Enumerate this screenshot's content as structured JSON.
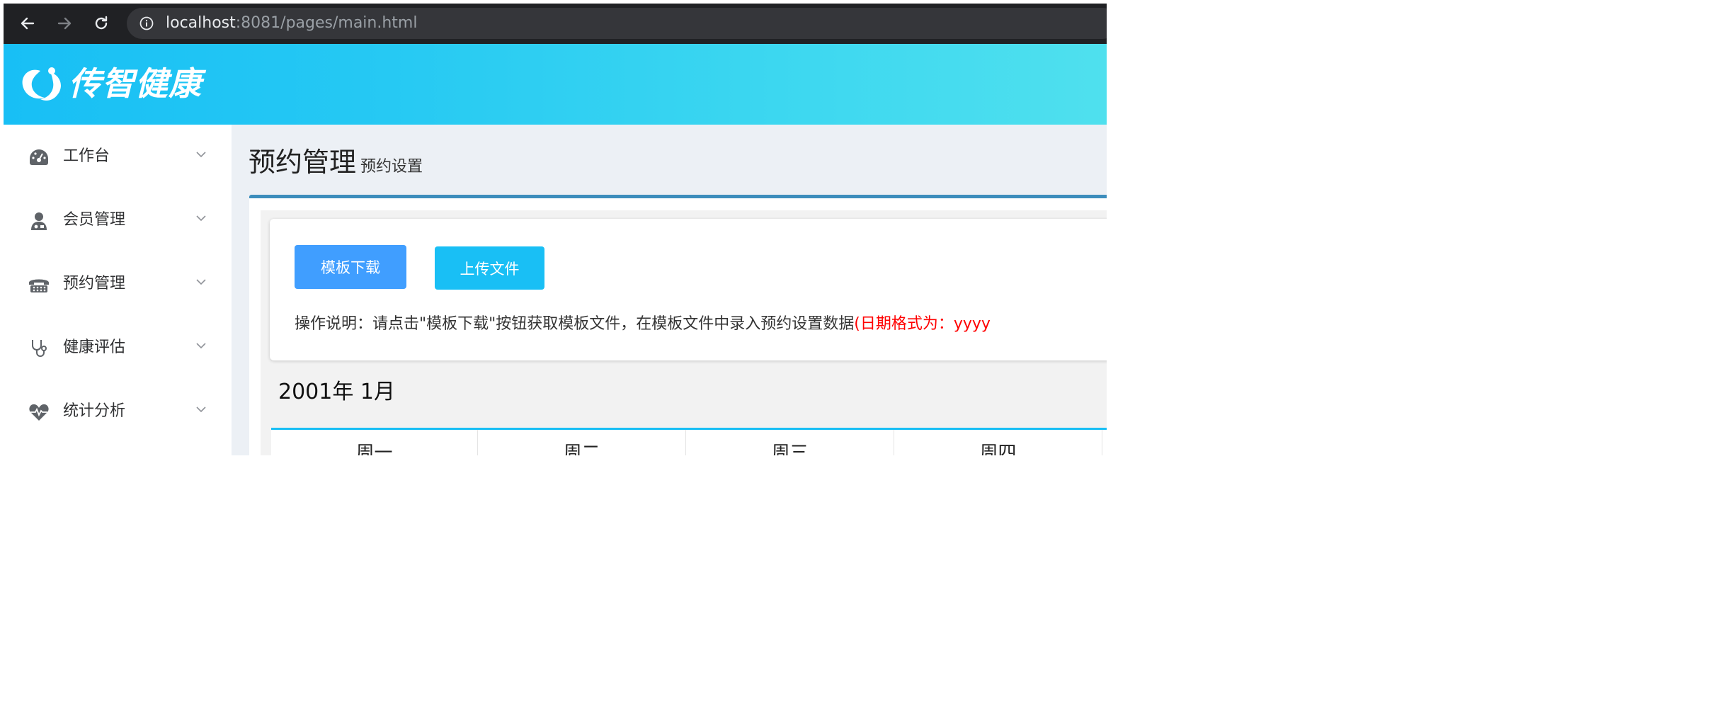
{
  "browser": {
    "url_host": "localhost",
    "url_path": ":8081/pages/main.html",
    "icons": [
      "back-arrow-icon",
      "forward-arrow-icon",
      "reload-icon",
      "info-icon"
    ]
  },
  "header": {
    "logo_text": "传智健康",
    "logo_icon": "logo-icon",
    "colors": {
      "gradient_start": "#18bff5",
      "gradient_end": "#4fe0ee"
    }
  },
  "sidebar": {
    "items": [
      {
        "label": "工作台",
        "icon": "dashboard-icon"
      },
      {
        "label": "会员管理",
        "icon": "member-icon"
      },
      {
        "label": "预约管理",
        "icon": "phone-icon"
      },
      {
        "label": "健康评估",
        "icon": "stethoscope-icon"
      },
      {
        "label": "统计分析",
        "icon": "heartbeat-icon"
      }
    ]
  },
  "main": {
    "title": "预约管理",
    "subtitle": "预约设置",
    "buttons": {
      "download": "模板下载",
      "upload": "上传文件"
    },
    "instructions": "操作说明：请点击\"模板下载\"按钮获取模板文件，在模板文件中录入预约设置数据",
    "instructions_red": "(日期格式为：yyyy",
    "calendar": {
      "title": "2001年 1月",
      "weekdays": [
        "周一",
        "周二",
        "周三",
        "周四"
      ]
    }
  }
}
